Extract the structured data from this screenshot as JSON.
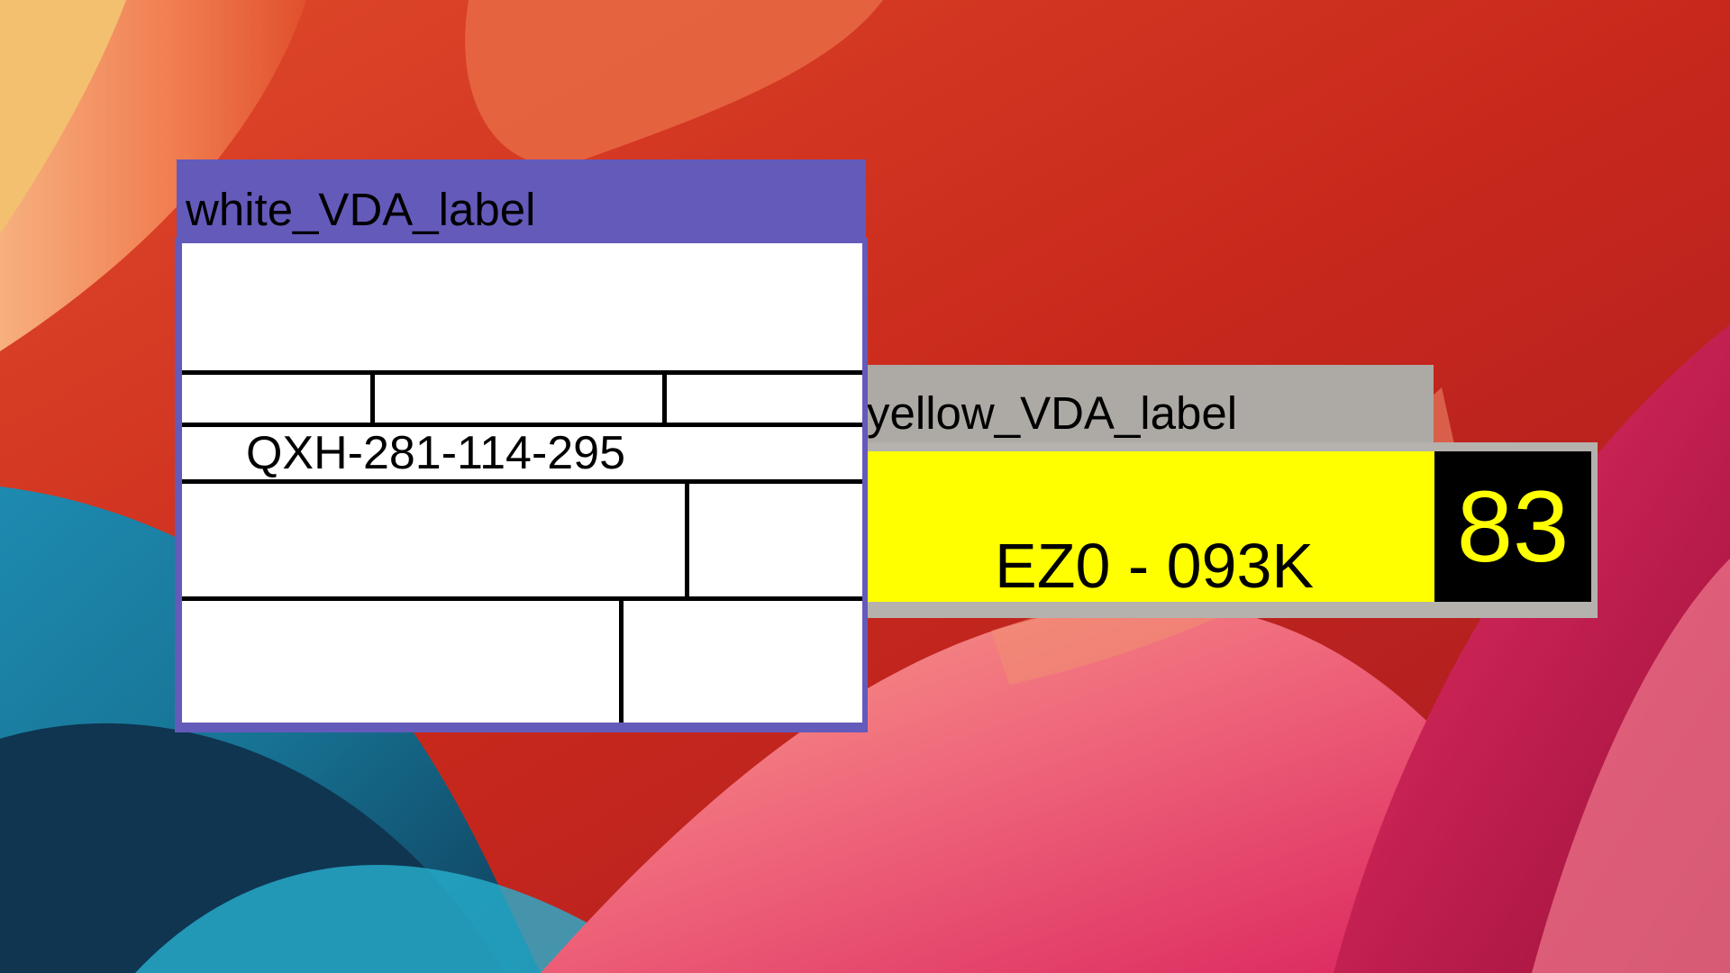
{
  "wallpaper": {
    "icon": "abstract-swirl-wallpaper",
    "colors": {
      "red": "#c8281c",
      "orange": "#f08a5e",
      "pink": "#f06a8c",
      "magenta": "#e0205e",
      "teal": "#1aa6c8",
      "navy": "#16405f"
    }
  },
  "white_label_window": {
    "title": "white_VDA_label",
    "code": "QXH-281-114-295",
    "colors": {
      "frame": "#645aba",
      "field": "#ffffff"
    }
  },
  "yellow_label_window": {
    "title": "yellow_VDA_label",
    "plate": "EZ0 - 093K",
    "number": "83",
    "colors": {
      "titlebar": "#ada9a5",
      "field": "#ffff00",
      "number_box": "#000000",
      "number_text": "#ffff00"
    }
  }
}
